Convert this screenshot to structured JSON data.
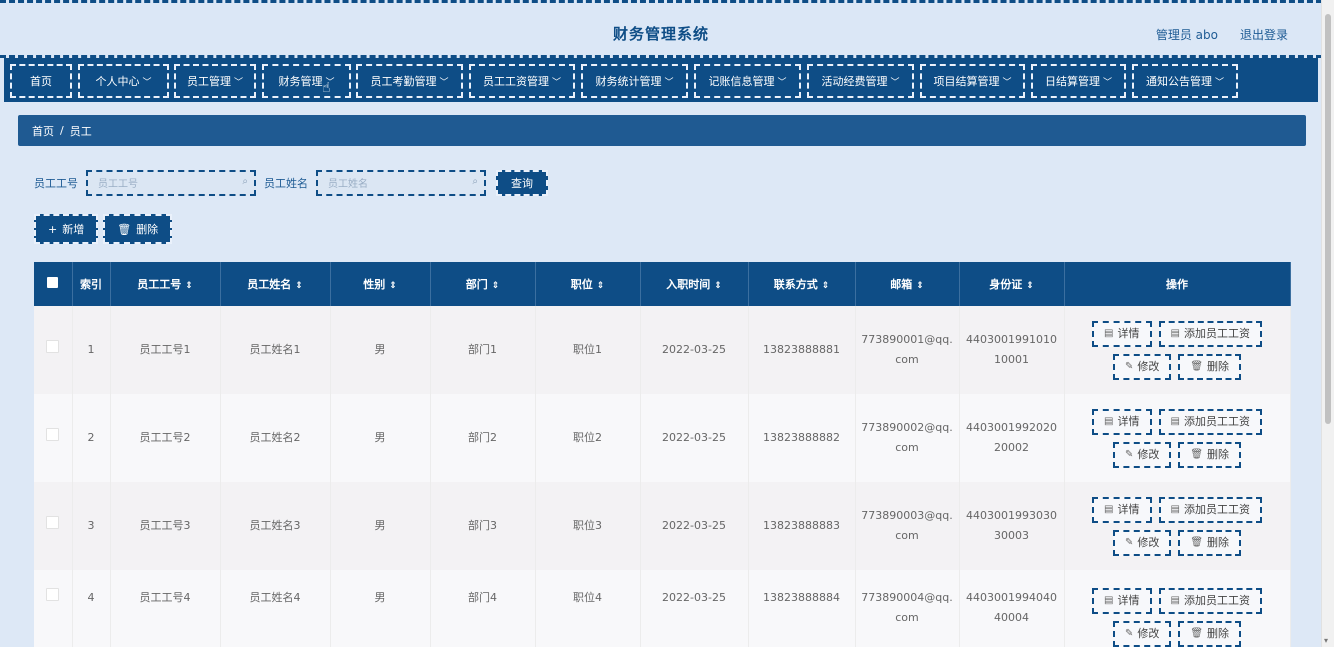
{
  "header": {
    "title": "财务管理系统",
    "admin_label": "管理员 abo",
    "logout_label": "退出登录"
  },
  "nav": [
    {
      "label": "首页",
      "chevron": false
    },
    {
      "label": "个人中心",
      "chevron": true
    },
    {
      "label": "员工管理",
      "chevron": true
    },
    {
      "label": "财务管理",
      "chevron": true
    },
    {
      "label": "员工考勤管理",
      "chevron": true
    },
    {
      "label": "员工工资管理",
      "chevron": true
    },
    {
      "label": "财务统计管理",
      "chevron": true
    },
    {
      "label": "记账信息管理",
      "chevron": true
    },
    {
      "label": "活动经费管理",
      "chevron": true
    },
    {
      "label": "项目结算管理",
      "chevron": true
    },
    {
      "label": "日结算管理",
      "chevron": true
    },
    {
      "label": "通知公告管理",
      "chevron": true
    }
  ],
  "breadcrumb": {
    "home": "首页",
    "separator": "/",
    "current": "员工"
  },
  "search": {
    "emp_no_label": "员工工号",
    "emp_no_placeholder": "员工工号",
    "emp_name_label": "员工姓名",
    "emp_name_placeholder": "员工姓名",
    "query_label": "查询"
  },
  "actions": {
    "add_label": "新增",
    "delete_label": "删除"
  },
  "table": {
    "columns": [
      "索引",
      "员工工号",
      "员工姓名",
      "性别",
      "部门",
      "职位",
      "入职时间",
      "联系方式",
      "邮箱",
      "身份证",
      "操作"
    ],
    "rows": [
      {
        "index": "1",
        "emp_no": "员工工号1",
        "name": "员工姓名1",
        "gender": "男",
        "dept": "部门1",
        "position": "职位1",
        "join_date": "2022-03-25",
        "phone": "13823888881",
        "email": "773890001@qq.com",
        "id_card": "440300199101010001"
      },
      {
        "index": "2",
        "emp_no": "员工工号2",
        "name": "员工姓名2",
        "gender": "男",
        "dept": "部门2",
        "position": "职位2",
        "join_date": "2022-03-25",
        "phone": "13823888882",
        "email": "773890002@qq.com",
        "id_card": "440300199202020002"
      },
      {
        "index": "3",
        "emp_no": "员工工号3",
        "name": "员工姓名3",
        "gender": "男",
        "dept": "部门3",
        "position": "职位3",
        "join_date": "2022-03-25",
        "phone": "13823888883",
        "email": "773890003@qq.com",
        "id_card": "440300199303030003"
      },
      {
        "index": "4",
        "emp_no": "员工工号4",
        "name": "员工姓名4",
        "gender": "男",
        "dept": "部门4",
        "position": "职位4",
        "join_date": "2022-03-25",
        "phone": "13823888884",
        "email": "773890004@qq.com",
        "id_card": "440300199404040004"
      }
    ],
    "row_actions": {
      "detail": "详情",
      "add_salary": "添加员工工资",
      "edit": "修改",
      "delete": "删除"
    }
  },
  "icons": {
    "sort": "sort-icon",
    "search": "search-icon",
    "plus": "plus-icon",
    "trash": "trash-icon",
    "document": "document-icon",
    "edit": "pencil-icon",
    "chevron": "chevron-down-icon",
    "cursor": "hand-pointer-icon"
  },
  "colors": {
    "primary": "#0e4d86",
    "background": "#dde8f6",
    "breadcrumb": "#1f5a92"
  }
}
